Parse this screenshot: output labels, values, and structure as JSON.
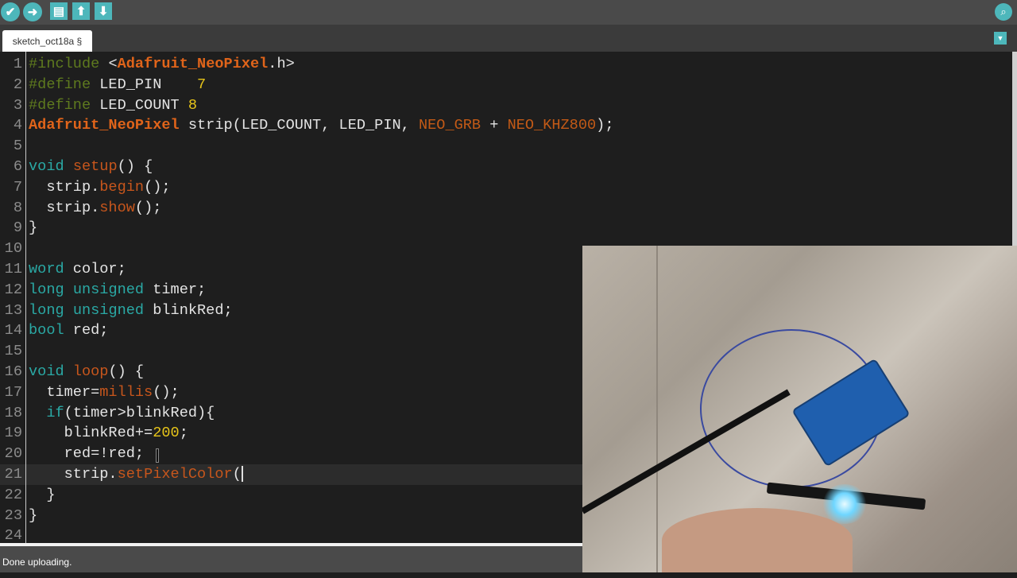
{
  "toolbar": {
    "buttons": [
      {
        "name": "verify",
        "icon": "check-icon",
        "glyph": "✔"
      },
      {
        "name": "upload",
        "icon": "arrow-right-icon",
        "glyph": "➜"
      },
      {
        "name": "new",
        "icon": "new-file-icon",
        "glyph": "▤"
      },
      {
        "name": "open",
        "icon": "arrow-up-icon",
        "glyph": "⬆"
      },
      {
        "name": "save",
        "icon": "arrow-down-icon",
        "glyph": "⬇"
      }
    ],
    "serial_monitor_glyph": "⌕"
  },
  "tab": {
    "label": "sketch_oct18a §",
    "menu_glyph": "▼"
  },
  "editor": {
    "current_line": 21,
    "lines": [
      [
        [
          "#include ",
          "pp"
        ],
        [
          "<",
          ""
        ],
        [
          "Adafruit_NeoPixel",
          "lib"
        ],
        [
          ".h>",
          ""
        ]
      ],
      [
        [
          "#define ",
          "pp"
        ],
        [
          "LED_PIN    ",
          ""
        ],
        [
          "7",
          "num"
        ]
      ],
      [
        [
          "#define ",
          "pp"
        ],
        [
          "LED_COUNT ",
          ""
        ],
        [
          "8",
          "num"
        ]
      ],
      [
        [
          "Adafruit_NeoPixel",
          "lib"
        ],
        [
          " strip(LED_COUNT, LED_PIN, ",
          ""
        ],
        [
          "NEO_GRB",
          "const"
        ],
        [
          " + ",
          ""
        ],
        [
          "NEO_KHZ800",
          "const"
        ],
        [
          ");",
          ""
        ]
      ],
      [],
      [
        [
          "void",
          "kw"
        ],
        [
          " ",
          ""
        ],
        [
          "setup",
          "fn"
        ],
        [
          "() {",
          ""
        ]
      ],
      [
        [
          "  strip.",
          ""
        ],
        [
          "begin",
          "fn"
        ],
        [
          "();",
          ""
        ]
      ],
      [
        [
          "  strip.",
          ""
        ],
        [
          "show",
          "fn"
        ],
        [
          "();",
          ""
        ]
      ],
      [
        [
          "}",
          ""
        ]
      ],
      [],
      [
        [
          "word",
          "kw"
        ],
        [
          " color;",
          ""
        ]
      ],
      [
        [
          "long",
          "kw"
        ],
        [
          " ",
          ""
        ],
        [
          "unsigned",
          "kw"
        ],
        [
          " timer;",
          ""
        ]
      ],
      [
        [
          "long",
          "kw"
        ],
        [
          " ",
          ""
        ],
        [
          "unsigned",
          "kw"
        ],
        [
          " blinkRed;",
          ""
        ]
      ],
      [
        [
          "bool",
          "kw"
        ],
        [
          " red;",
          ""
        ]
      ],
      [],
      [
        [
          "void",
          "kw"
        ],
        [
          " ",
          ""
        ],
        [
          "loop",
          "fn"
        ],
        [
          "() {",
          ""
        ]
      ],
      [
        [
          "  timer=",
          ""
        ],
        [
          "millis",
          "fn"
        ],
        [
          "();",
          ""
        ]
      ],
      [
        [
          "  ",
          ""
        ],
        [
          "if",
          "kw"
        ],
        [
          "(timer>blinkRed){",
          ""
        ]
      ],
      [
        [
          "    blinkRed+=",
          ""
        ],
        [
          "200",
          "num"
        ],
        [
          ";",
          ""
        ]
      ],
      [
        [
          "    red=!red;",
          ""
        ]
      ],
      [
        [
          "    strip.",
          ""
        ],
        [
          "setPixelColor",
          "fn"
        ],
        [
          "(",
          ""
        ]
      ],
      [
        [
          "  }",
          ""
        ]
      ],
      [
        [
          "}",
          ""
        ]
      ],
      []
    ]
  },
  "status": {
    "message": "Done uploading."
  }
}
